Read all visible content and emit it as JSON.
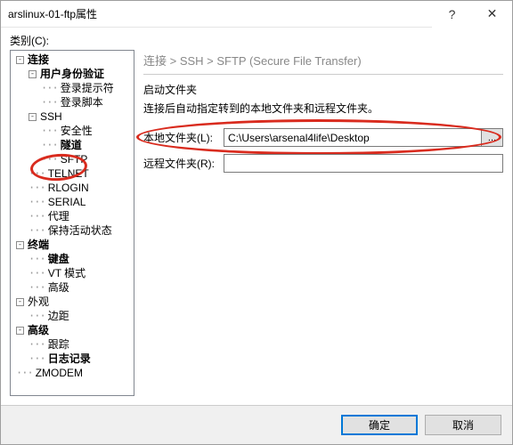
{
  "window": {
    "title": "arslinux-01-ftp属性"
  },
  "category_label": "类别(C):",
  "tree": {
    "root": "连接",
    "auth": "用户身份验证",
    "login_prompt": "登录提示符",
    "login_script": "登录脚本",
    "ssh": "SSH",
    "security": "安全性",
    "tunnel": "隧道",
    "sftp": "SFTP",
    "telnet": "TELNET",
    "rlogin": "RLOGIN",
    "serial": "SERIAL",
    "proxy": "代理",
    "keepalive": "保持活动状态",
    "terminal": "终端",
    "keyboard": "键盘",
    "vtmode": "VT 模式",
    "advanced1": "高级",
    "appearance": "外观",
    "margin": "边距",
    "advanced2": "高级",
    "trace": "跟踪",
    "logging": "日志记录",
    "zmodem": "ZMODEM"
  },
  "breadcrumb": "连接 > SSH > SFTP (Secure File Transfer)",
  "panel": {
    "section_title": "启动文件夹",
    "section_desc": "连接后自动指定转到的本地文件夹和远程文件夹。",
    "local_label": "本地文件夹(L):",
    "remote_label": "远程文件夹(R):",
    "local_value": "C:\\Users\\arsenal4life\\Desktop",
    "remote_value": "",
    "browse": "..."
  },
  "buttons": {
    "ok": "确定",
    "cancel": "取消"
  }
}
